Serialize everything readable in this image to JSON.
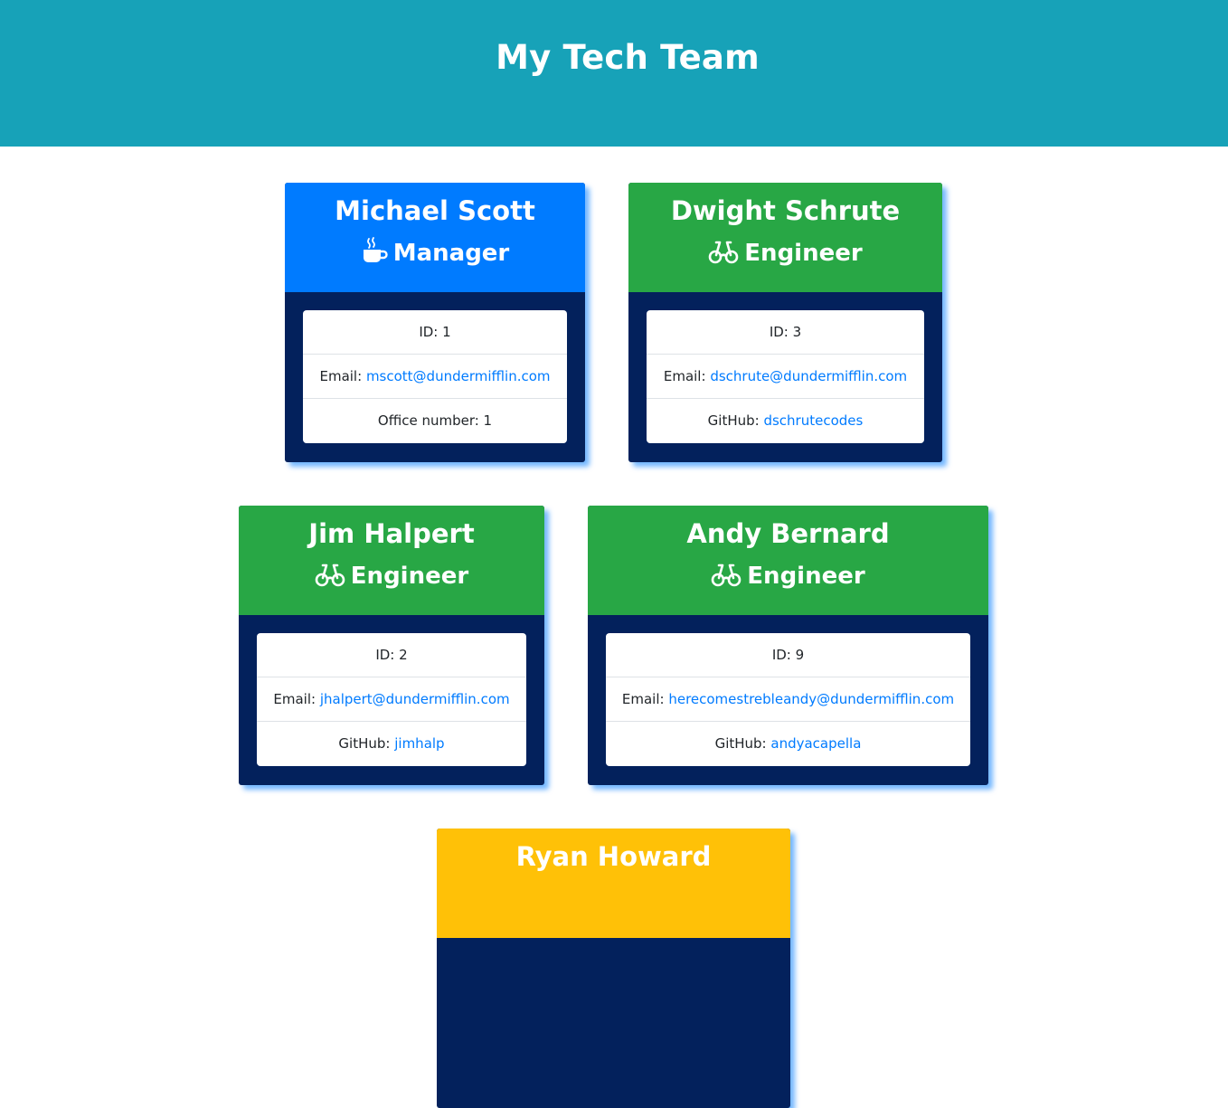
{
  "header": {
    "title": "My Tech Team"
  },
  "colors": {
    "header": "#17a2b8",
    "manager": "#007bff",
    "engineer": "#28a745",
    "intern": "#ffc107",
    "card_body": "#03215c",
    "link": "#007bff"
  },
  "employees": [
    {
      "name": "Michael Scott",
      "role": "Manager",
      "icon": "coffee-mug-icon",
      "id_text": "ID: 1",
      "email_label": "Email: ",
      "email": "mscott@dundermifflin.com",
      "extra_label": "Office number: 1",
      "extra_value": ""
    },
    {
      "name": "Dwight Schrute",
      "role": "Engineer",
      "icon": "glasses-icon",
      "id_text": "ID: 3",
      "email_label": "Email: ",
      "email": "dschrute@dundermifflin.com",
      "extra_label": "GitHub: ",
      "extra_value": "dschrutecodes"
    },
    {
      "name": "Jim Halpert",
      "role": "Engineer",
      "icon": "glasses-icon",
      "id_text": "ID: 2",
      "email_label": "Email: ",
      "email": "jhalpert@dundermifflin.com",
      "extra_label": "GitHub: ",
      "extra_value": "jimhalp"
    },
    {
      "name": "Andy Bernard",
      "role": "Engineer",
      "icon": "glasses-icon",
      "id_text": "ID: 9",
      "email_label": "Email: ",
      "email": "herecomestrebleandy@dundermifflin.com",
      "extra_label": "GitHub: ",
      "extra_value": "andyacapella"
    },
    {
      "name": "Ryan Howard"
    }
  ]
}
